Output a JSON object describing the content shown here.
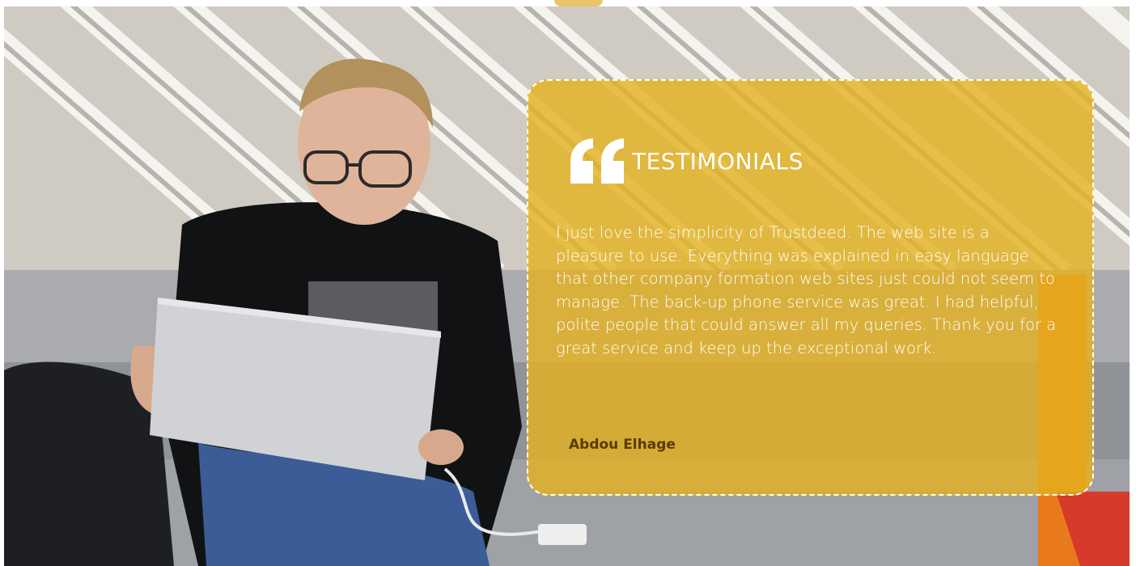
{
  "testimonial": {
    "title": "TESTIMONIALS",
    "quote": "I just love the simplicity of Trustdeed. The web site is a pleasure to use. Everything was explained in easy language that other company formation web sites just could not seem to manage. The back-up phone service was great. I had helpful, polite people that could answer all my queries. Thank you for a great service and keep up the exceptional work.",
    "author": "Abdou Elhage"
  },
  "icons": {
    "quote": "quote-icon"
  },
  "colors": {
    "card_overlay": "#e4b21e",
    "card_border": "#ffffff",
    "title_text": "#ffffff",
    "author_text": "#5a3a00"
  }
}
